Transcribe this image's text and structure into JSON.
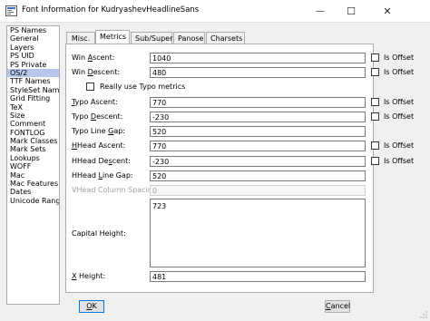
{
  "window": {
    "title": "Font Information for KudryashevHeadlineSans",
    "minimize_glyph": "—",
    "maximize_glyph": "☐",
    "close_glyph": "✕"
  },
  "sidebar": {
    "items": [
      {
        "label": "PS Names"
      },
      {
        "label": "General"
      },
      {
        "label": "Layers"
      },
      {
        "label": "PS UID"
      },
      {
        "label": "PS Private"
      },
      {
        "label": "OS/2"
      },
      {
        "label": "TTF Names"
      },
      {
        "label": "StyleSet Names"
      },
      {
        "label": "Grid Fitting"
      },
      {
        "label": "TeX"
      },
      {
        "label": "Size"
      },
      {
        "label": "Comment"
      },
      {
        "label": "FONTLOG"
      },
      {
        "label": "Mark Classes"
      },
      {
        "label": "Mark Sets"
      },
      {
        "label": "Lookups"
      },
      {
        "label": "WOFF"
      },
      {
        "label": "Mac"
      },
      {
        "label": "Mac Features"
      },
      {
        "label": "Dates"
      },
      {
        "label": "Unicode Ranges"
      }
    ],
    "selected": "OS/2"
  },
  "tabs": {
    "misc": "Misc.",
    "metrics": "Metrics",
    "subsuper": "Sub/Super",
    "panose": "Panose",
    "charsets": "Charsets",
    "active": "Metrics"
  },
  "metrics": {
    "win_ascent": {
      "pre": "Win ",
      "u": "A",
      "post": "scent:",
      "value": "1040"
    },
    "win_descent": {
      "pre": "Win ",
      "u": "D",
      "post": "escent:",
      "value": "480"
    },
    "really_use_typo": {
      "label": "Really use Typo metrics",
      "checked": false
    },
    "typo_ascent": {
      "pre": "",
      "u": "T",
      "post": "ypo Ascent:",
      "value": "770"
    },
    "typo_descent": {
      "pre": "Typo ",
      "u": "D",
      "post": "escent:",
      "value": "-230"
    },
    "typo_line_gap": {
      "pre": "Typo Line ",
      "u": "G",
      "post": "ap:",
      "value": "520"
    },
    "hhead_ascent": {
      "pre": "",
      "u": "H",
      "post": "Head Ascent:",
      "value": "770"
    },
    "hhead_descent": {
      "pre": "HHead De",
      "u": "s",
      "post": "cent:",
      "value": "-230"
    },
    "hhead_line_gap": {
      "pre": "HHead ",
      "u": "L",
      "post": "ine Gap:",
      "value": "520"
    },
    "vhead_column_spacing": {
      "label": "VHead Column Spacing:",
      "value": "0",
      "disabled": true
    },
    "capital_height": {
      "label": "Capital Height:",
      "value": "723"
    },
    "x_height": {
      "pre": "",
      "u": "X",
      "post": " Height:",
      "value": "481"
    },
    "is_offset_label": "Is Offset"
  },
  "buttons": {
    "ok": {
      "u": "O",
      "post": "K"
    },
    "cancel": {
      "u": "C",
      "post": "ancel"
    }
  }
}
